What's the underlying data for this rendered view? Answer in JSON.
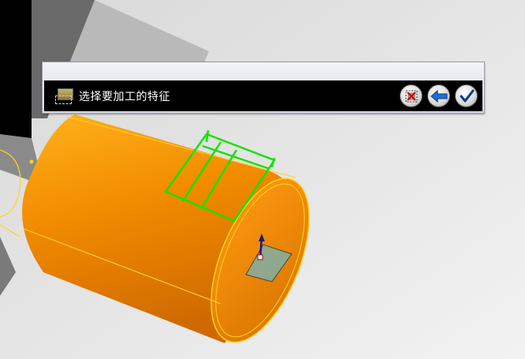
{
  "prompt": {
    "text": "选择要加工的特征",
    "icons": {
      "feature": "feature-icon",
      "cancel": "cancel-selection-icon",
      "back": "back-arrow-icon",
      "confirm": "checkmark-icon"
    }
  },
  "colors": {
    "background": "#e6e6e6",
    "cylinder": "#f08a00",
    "edge_highlight": "#ffd21f",
    "feature_highlight": "#18e100",
    "dark_gray_block": "#6a6a6a",
    "prompt_bar": "#000000"
  }
}
